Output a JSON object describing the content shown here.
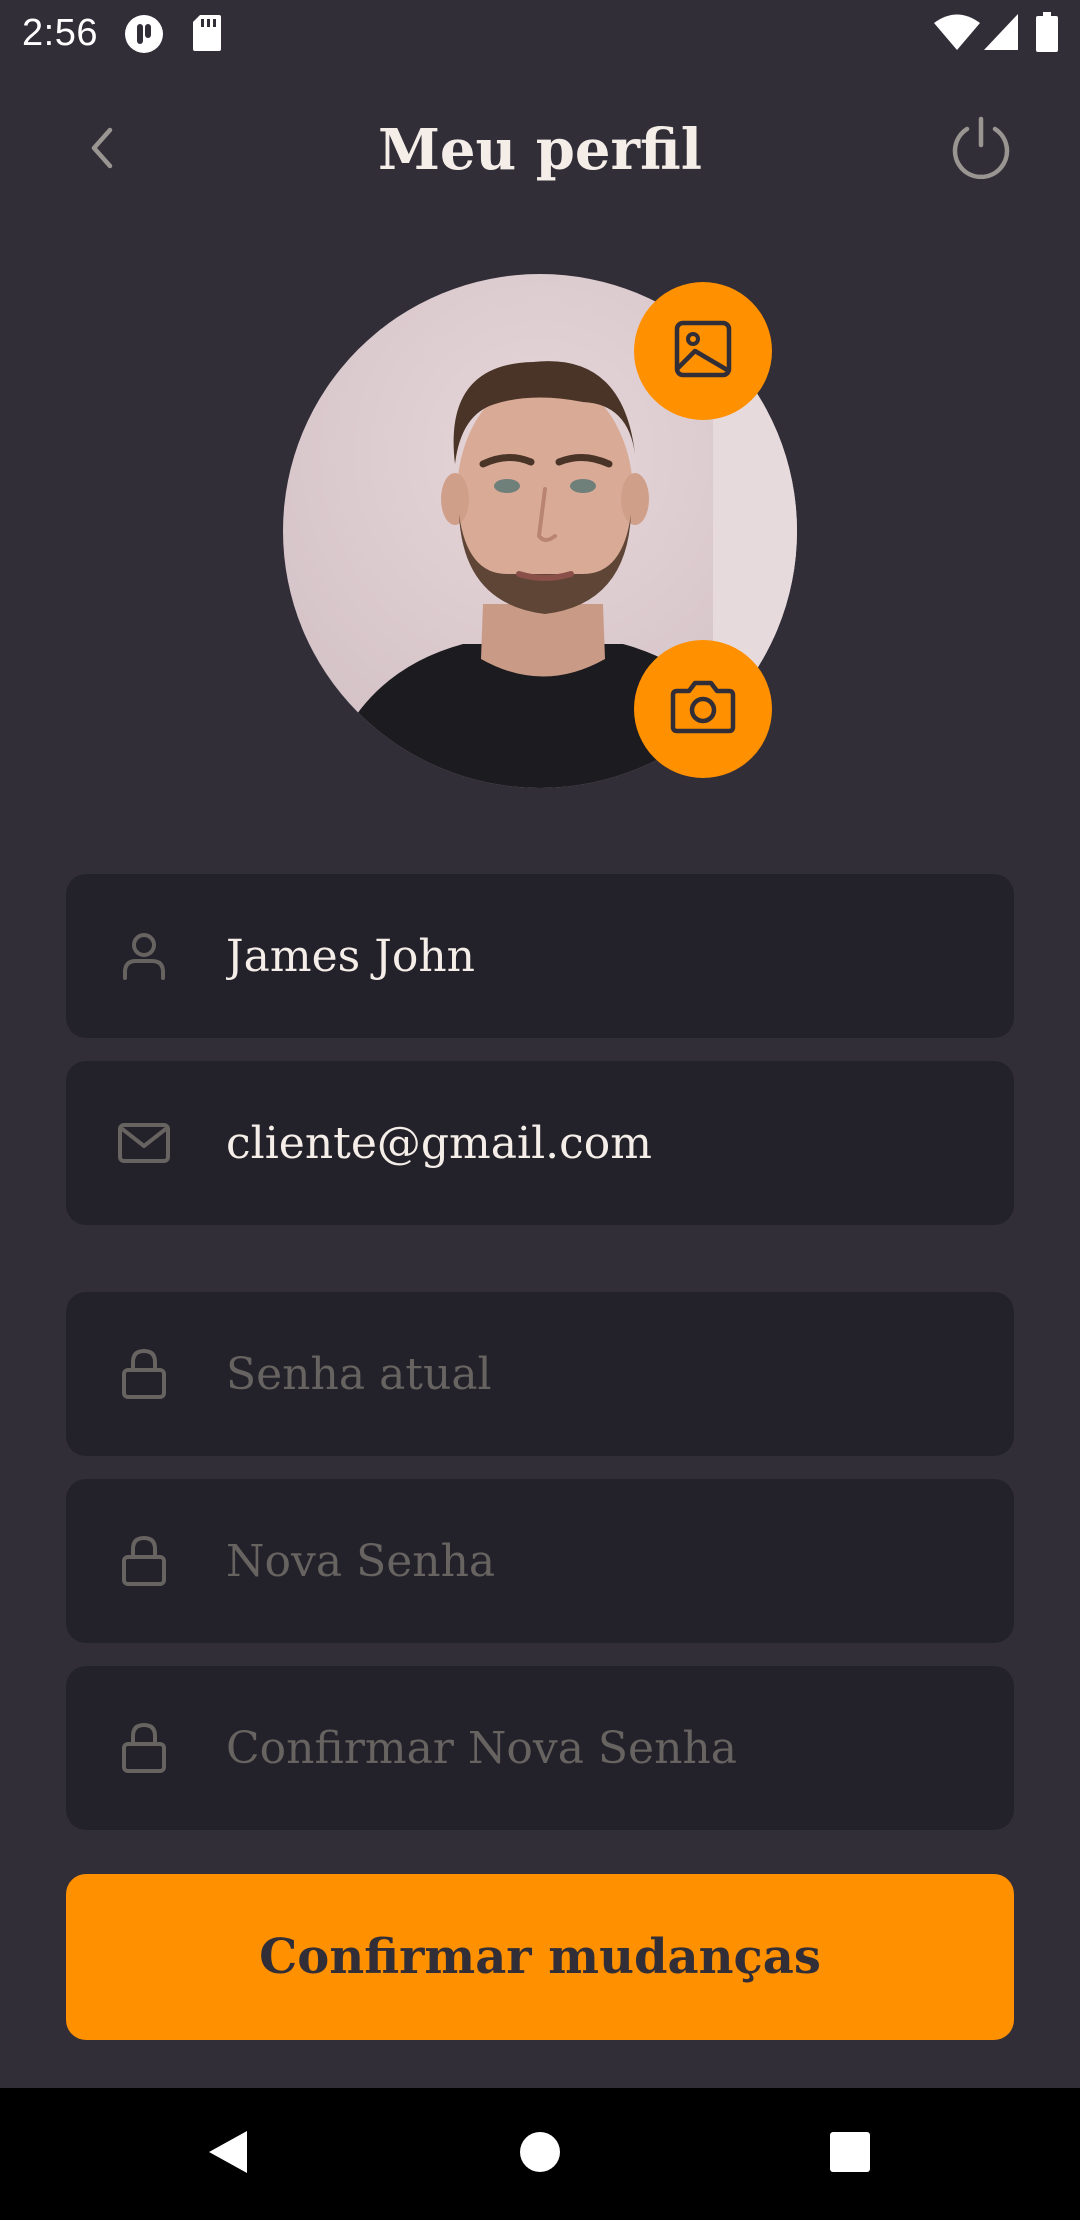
{
  "status_bar": {
    "time": "2:56",
    "icons": [
      "notification-app-icon",
      "sd-card-icon",
      "wifi-icon",
      "cellular-signal-icon",
      "battery-icon"
    ]
  },
  "header": {
    "title": "Meu perfil",
    "back_icon": "chevron-left-icon",
    "power_icon": "power-icon"
  },
  "profile": {
    "avatar_icon": "avatar-photo",
    "gallery_icon": "image-icon",
    "camera_icon": "camera-icon"
  },
  "form": {
    "name": {
      "value": "James John",
      "icon": "user-icon"
    },
    "email": {
      "value": "cliente@gmail.com",
      "icon": "mail-icon"
    },
    "current_password": {
      "value": "",
      "placeholder": "Senha atual",
      "icon": "lock-icon"
    },
    "new_password": {
      "value": "",
      "placeholder": "Nova Senha",
      "icon": "lock-icon"
    },
    "confirm_password": {
      "value": "",
      "placeholder": "Confirmar Nova Senha",
      "icon": "lock-icon"
    }
  },
  "submit": {
    "label": "Confirmar mudanças"
  },
  "nav_bar": {
    "icons": [
      "nav-back-icon",
      "nav-home-icon",
      "nav-recents-icon"
    ]
  },
  "colors": {
    "background": "#312e38",
    "field_background": "#232129",
    "accent": "#ff9000",
    "text": "#f4ede8",
    "placeholder": "#666360",
    "icon_muted": "#999591"
  }
}
